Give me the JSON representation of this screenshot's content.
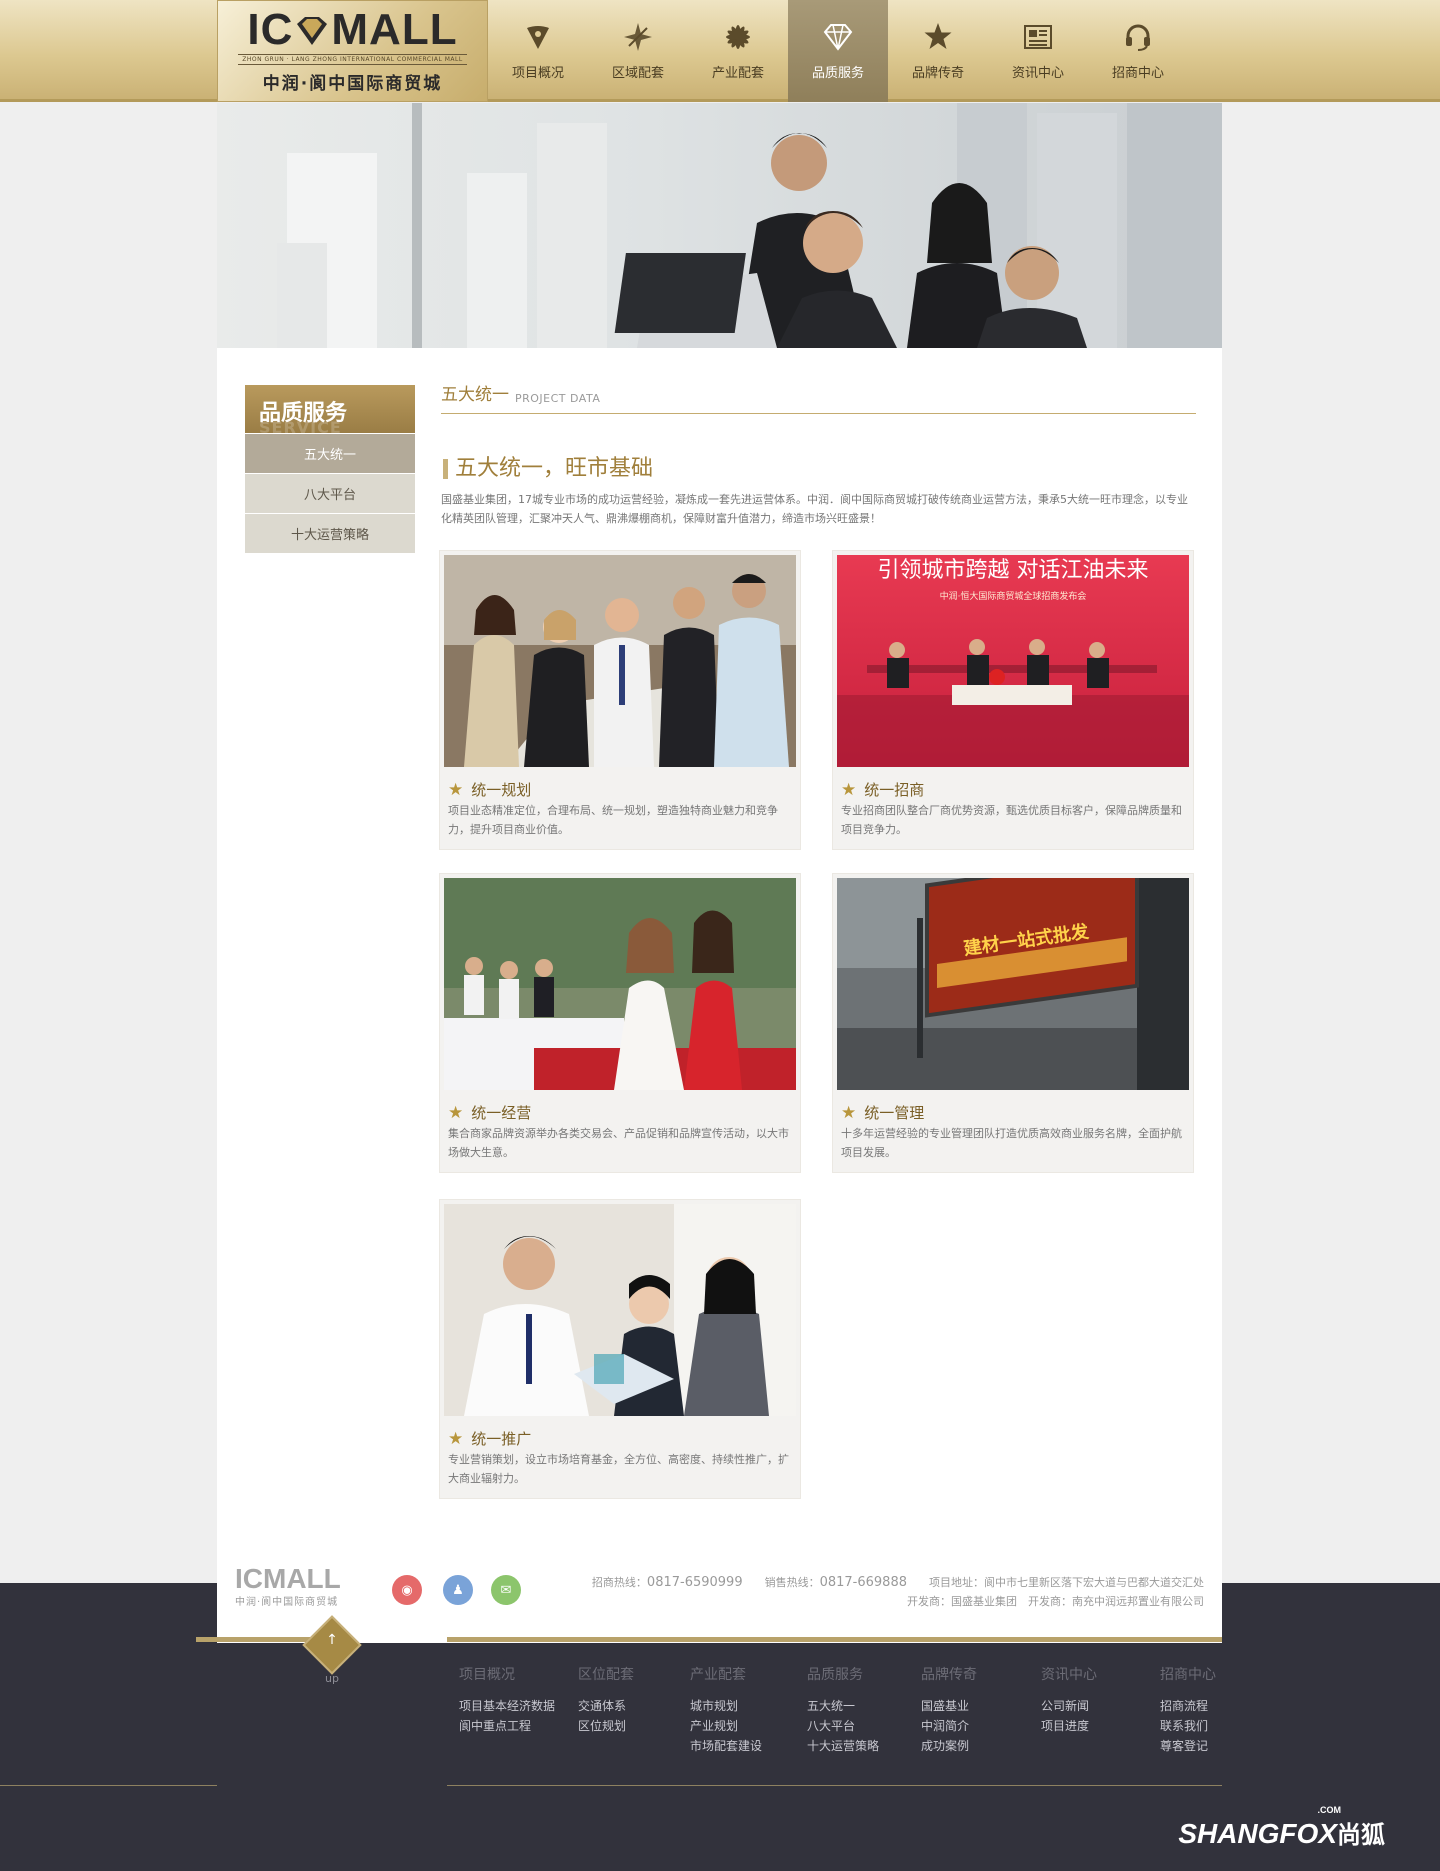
{
  "header": {
    "logo_en": "IC",
    "logo_en_tail": "MALL",
    "logo_sub": "ZHON GRUN · LANG ZHONG INTERNATIONAL COMMERCIAL MALL",
    "logo_cn": "中润·阆中国际商贸城",
    "nav": [
      {
        "label": "项目概况",
        "icon": "pin-icon"
      },
      {
        "label": "区域配套",
        "icon": "compass-icon"
      },
      {
        "label": "产业配套",
        "icon": "flower-icon"
      },
      {
        "label": "品质服务",
        "icon": "diamond-icon",
        "active": true
      },
      {
        "label": "品牌传奇",
        "icon": "star-icon"
      },
      {
        "label": "资讯中心",
        "icon": "news-icon"
      },
      {
        "label": "招商中心",
        "icon": "headset-icon"
      }
    ]
  },
  "sidebar": {
    "title": "品质服务",
    "ghost": "SERVICE",
    "items": [
      {
        "label": "五大统一",
        "active": true
      },
      {
        "label": "八大平台"
      },
      {
        "label": "十大运营策略"
      }
    ]
  },
  "content": {
    "title_cn": "五大统一",
    "title_en": "PROJECT DATA",
    "heading": "五大统一，旺市基础",
    "intro": "国盛基业集团，17城专业市场的成功运营经验，凝炼成一套先进运营体系。中润．阆中国际商贸城打破传统商业运营方法，秉承5大统一旺市理念，以专业化精英团队管理，汇聚冲天人气、鼎沸爆棚商机，保障财富升值潜力，缔造市场兴旺盛景！",
    "cards": [
      {
        "title": "统一规划",
        "desc": "项目业态精准定位，合理布局、统一规划，塑造独特商业魅力和竞争力，提升项目商业价值。"
      },
      {
        "title": "统一招商",
        "desc": "专业招商团队整合厂商优势资源，甄选优质目标客户，保障品牌质量和项目竞争力。",
        "banner_text": "引领城市跨越 对话江油未来",
        "banner_sub": "中润·恒大国际商贸城全球招商发布会"
      },
      {
        "title": "统一经营",
        "desc": "集合商家品牌资源举办各类交易会、产品促销和品牌宣传活动，以大市场做大生意。"
      },
      {
        "title": "统一管理",
        "desc": "十多年运营经验的专业管理团队打造优质高效商业服务名牌，全面护航项目发展。",
        "billboard_text": "建材一站式批发"
      },
      {
        "title": "统一推广",
        "desc": "专业营销策划，设立市场培育基金，全方位、高密度、持续性推广，扩大商业辐射力。"
      }
    ]
  },
  "footer": {
    "logo_en": "ICMALL",
    "logo_cn": "中润·阆中国际商贸城",
    "hotline_label": "招商热线：",
    "hotline": "0817-6590999",
    "sales_label": "销售热线：",
    "sales": "0817-669888",
    "address": "项目地址：阆中市七里新区落下宏大道与巴都大道交汇处",
    "developers": "开发商：国盛基业集团　开发商：南充中润远邦置业有限公司",
    "up": "up",
    "columns": [
      {
        "head": "项目概况",
        "links": [
          "项目基本经济数据",
          "阆中重点工程"
        ]
      },
      {
        "head": "区位配套",
        "links": [
          "交通体系",
          "区位规划"
        ]
      },
      {
        "head": "产业配套",
        "links": [
          "城市规划",
          "产业规划",
          "市场配套建设"
        ]
      },
      {
        "head": "品质服务",
        "links": [
          "五大统一",
          "八大平台",
          "十大运营策略"
        ]
      },
      {
        "head": "品牌传奇",
        "links": [
          "国盛基业",
          "中润简介",
          "成功案例"
        ]
      },
      {
        "head": "资讯中心",
        "links": [
          "公司新闻",
          "项目进度"
        ]
      },
      {
        "head": "招商中心",
        "links": [
          "招商流程",
          "联系我们",
          "尊客登记"
        ]
      }
    ],
    "brand": "SHANGFOX",
    "brand_cn": "尚狐",
    "brand_com": ".COM"
  },
  "colors": {
    "gold": "#b8a26a",
    "dark": "#32323c",
    "accent_text": "#a07f3b"
  }
}
